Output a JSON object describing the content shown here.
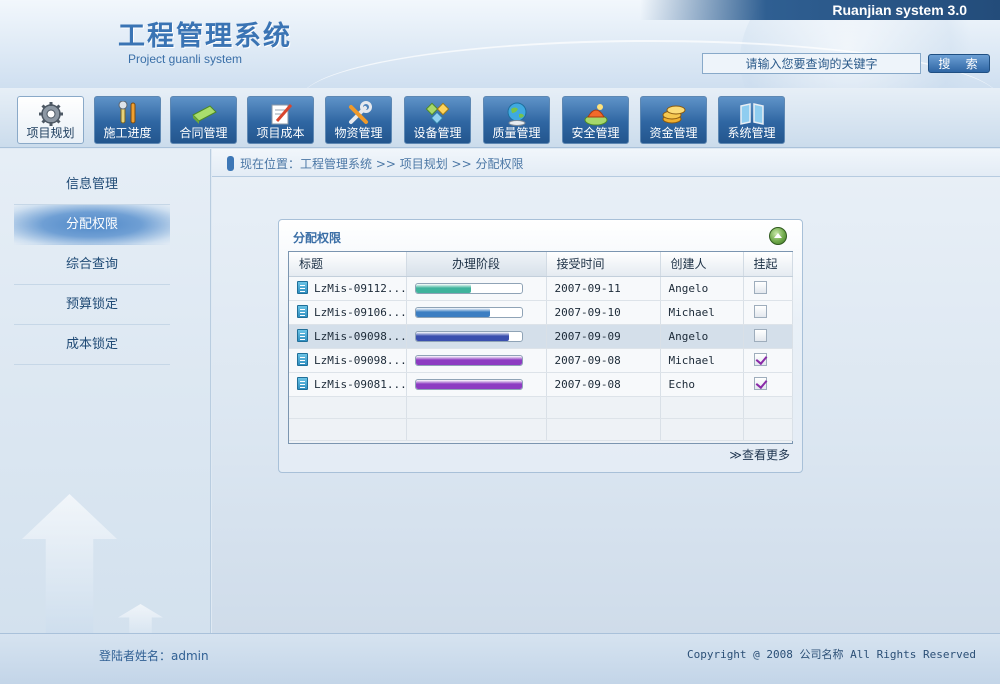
{
  "header": {
    "version": "Ruanjian system 3.0",
    "title": "工程管理系统",
    "subtitle": "Project guanli system",
    "search_placeholder": "请输入您要查询的关键字",
    "search_button": "搜 索"
  },
  "nav": {
    "items": [
      {
        "label": "项目规划",
        "icon": "gear-icon",
        "active": true
      },
      {
        "label": "施工进度",
        "icon": "tools-icon"
      },
      {
        "label": "合同管理",
        "icon": "contract-icon"
      },
      {
        "label": "项目成本",
        "icon": "cost-icon"
      },
      {
        "label": "物资管理",
        "icon": "wrench-icon"
      },
      {
        "label": "设备管理",
        "icon": "equipment-icon"
      },
      {
        "label": "质量管理",
        "icon": "globe-icon"
      },
      {
        "label": "安全管理",
        "icon": "safety-icon"
      },
      {
        "label": "资金管理",
        "icon": "coins-icon"
      },
      {
        "label": "系统管理",
        "icon": "system-icon"
      }
    ]
  },
  "sidebar": {
    "items": [
      {
        "label": "信息管理"
      },
      {
        "label": "分配权限",
        "active": true
      },
      {
        "label": "综合查询"
      },
      {
        "label": "预算锁定"
      },
      {
        "label": "成本锁定"
      }
    ]
  },
  "breadcrumb": {
    "text": "现在位置：工程管理系统 >> 项目规划 >> 分配权限"
  },
  "panel": {
    "title": "分配权限",
    "more_link": "≫查看更多",
    "columns": [
      "标题",
      "办理阶段",
      "接受时间",
      "创建人",
      "挂起"
    ],
    "rows": [
      {
        "title": "LzMis-09112...",
        "progress": 0.52,
        "color": "#3fb39c",
        "date": "2007-09-11",
        "creator": "Angelo",
        "suspended": false
      },
      {
        "title": "LzMis-09106...",
        "progress": 0.7,
        "color": "#3c7ec2",
        "date": "2007-09-10",
        "creator": "Michael",
        "suspended": false
      },
      {
        "title": "LzMis-09098...",
        "progress": 0.88,
        "color": "#3a4fae",
        "date": "2007-09-09",
        "creator": "Angelo",
        "suspended": false,
        "selected": true
      },
      {
        "title": "LzMis-09098...",
        "progress": 1.0,
        "color": "#8d3cc2",
        "date": "2007-09-08",
        "creator": "Michael",
        "suspended": true
      },
      {
        "title": "LzMis-09081...",
        "progress": 1.0,
        "color": "#8d3cc2",
        "date": "2007-09-08",
        "creator": "Echo",
        "suspended": true
      }
    ]
  },
  "footer": {
    "login": "登陆者姓名：admin",
    "copyright": "Copyright @ 2008 公司名称 All Rights Reserved"
  }
}
